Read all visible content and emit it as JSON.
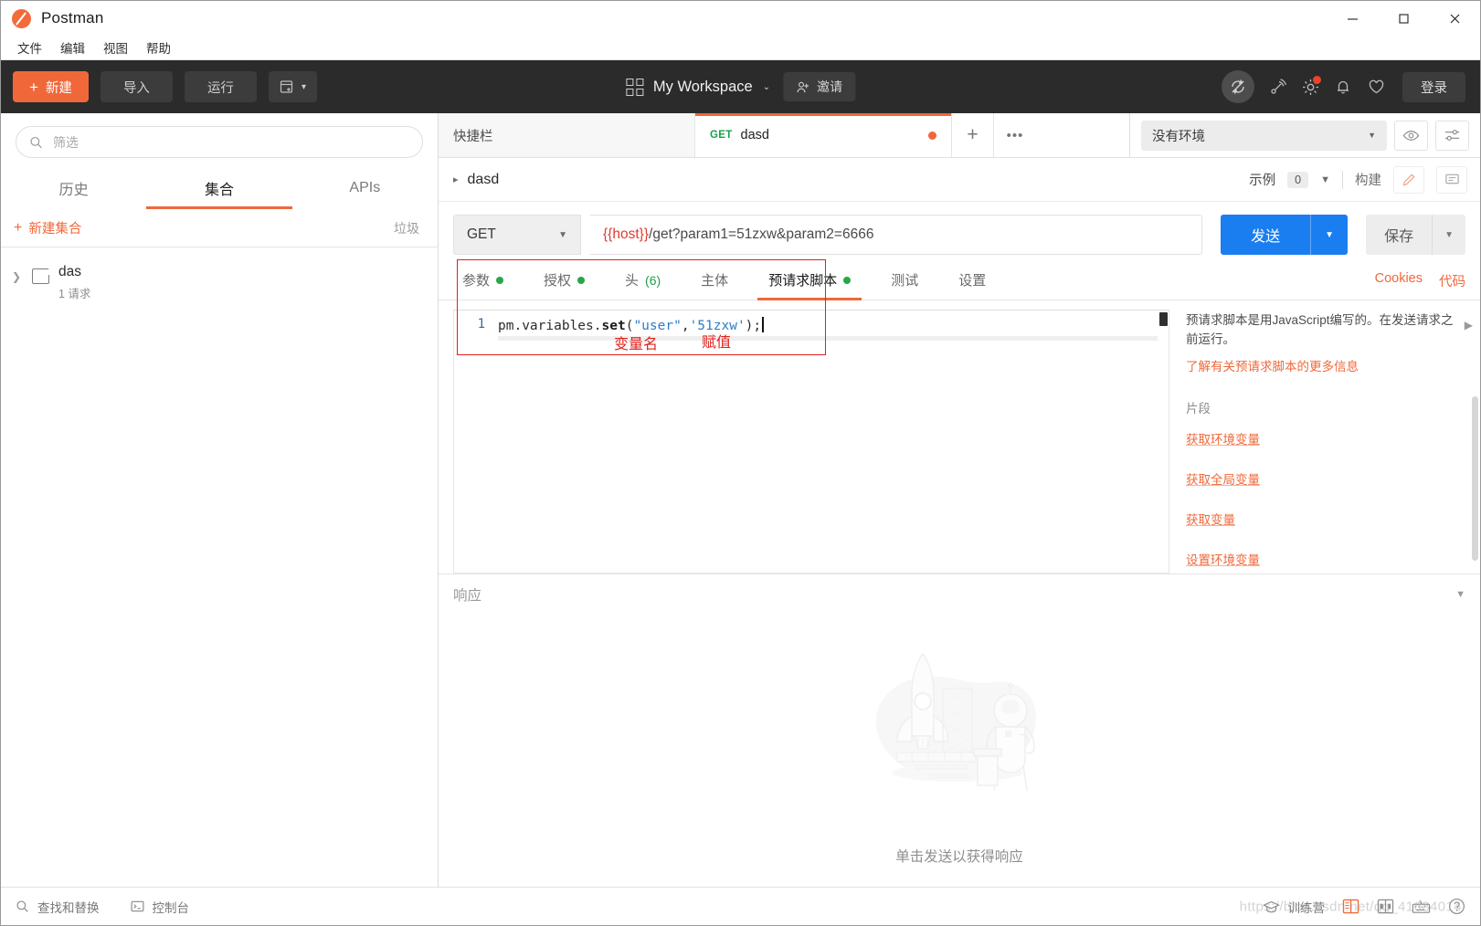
{
  "window": {
    "app_title": "Postman",
    "minimize": "—",
    "maximize": "□",
    "close": "✕"
  },
  "menubar": {
    "items": [
      "文件",
      "编辑",
      "视图",
      "帮助"
    ]
  },
  "header": {
    "new_button": "新建",
    "import_button": "导入",
    "runner_button": "运行",
    "workspace_name": "My Workspace",
    "invite_button": "邀请",
    "login_button": "登录",
    "icons": [
      "sync-off-icon",
      "satellite-icon",
      "gear-icon",
      "bell-icon",
      "heart-icon"
    ],
    "accent_color": "#f0683a",
    "bg_color": "#2b2b2b"
  },
  "sidebar": {
    "filter_placeholder": "筛选",
    "filter_value": "",
    "tabs": [
      {
        "label": "历史",
        "active": false
      },
      {
        "label": "集合",
        "active": true
      },
      {
        "label": "APIs",
        "active": false
      }
    ],
    "new_collection": "新建集合",
    "trash": "垃圾",
    "collections": [
      {
        "name": "das",
        "sub": "1 请求"
      }
    ]
  },
  "tabstrip": {
    "tabs": [
      {
        "label": "快捷栏",
        "method": "",
        "active": false,
        "unsaved": false
      },
      {
        "label": "dasd",
        "method": "GET",
        "active": true,
        "unsaved": true
      }
    ],
    "add_tab": "+",
    "more_tabs": "•••",
    "environment": "没有环境",
    "eye_icon": "eye-icon",
    "settings_icon": "sliders-icon"
  },
  "request": {
    "name": "dasd",
    "examples_label": "示例",
    "examples_count": "0",
    "build_label": "构建",
    "method": "GET",
    "url_prefix": "{{host}}",
    "url_rest": "/get?param1=51zxw&param2=6666",
    "send_button": "发送",
    "save_button": "保存",
    "tabs": [
      {
        "label": "参数",
        "dot": true,
        "count": "",
        "active": false
      },
      {
        "label": "授权",
        "dot": true,
        "count": "",
        "active": false
      },
      {
        "label": "头",
        "dot": false,
        "count": "(6)",
        "active": false
      },
      {
        "label": "主体",
        "dot": false,
        "count": "",
        "active": false
      },
      {
        "label": "预请求脚本",
        "dot": true,
        "count": "",
        "active": true
      },
      {
        "label": "测试",
        "dot": false,
        "count": "",
        "active": false
      },
      {
        "label": "设置",
        "dot": false,
        "count": "",
        "active": false
      }
    ],
    "cookies_link": "Cookies",
    "code_link": "代码"
  },
  "editor": {
    "line_number": "1",
    "code_parts": {
      "obj": "pm.variables.",
      "fn": "set",
      "open": "(",
      "arg1": "\"user\"",
      "comma": ",",
      "arg2": "'51zxw'",
      "close": ");"
    },
    "full_code": "pm.variables.set(\"user\",'51zxw');"
  },
  "annotations": {
    "variable_name": "变量名",
    "assignment": "赋值",
    "color": "#e2201a"
  },
  "snippets": {
    "description": "预请求脚本是用JavaScript编写的。在发送请求之前运行。",
    "more_link": "了解有关预请求脚本的更多信息",
    "heading": "片段",
    "items": [
      "获取环境变量",
      "获取全局变量",
      "获取变量",
      "设置环境变量"
    ]
  },
  "response": {
    "title": "响应",
    "empty_hint": "单击发送以获得响应"
  },
  "statusbar": {
    "find_replace": "查找和替换",
    "console": "控制台",
    "bootcamp": "训练营",
    "watermark": "https://blog.csdn.net/qq_41684014",
    "icons": [
      "two-pane-icon",
      "split-pane-icon",
      "keyboard-icon",
      "help-icon"
    ]
  }
}
